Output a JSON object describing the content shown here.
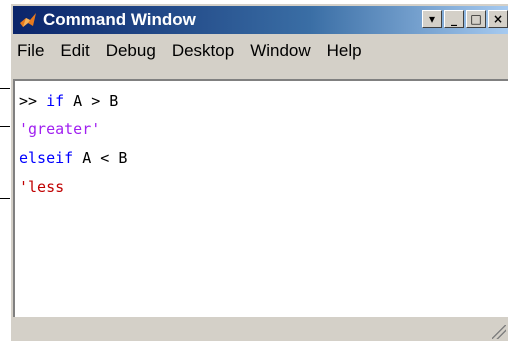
{
  "window": {
    "title": "Command Window",
    "buttons": [
      "▾",
      "_",
      "□",
      "×"
    ]
  },
  "menu": [
    "File",
    "Edit",
    "Debug",
    "Desktop",
    "Window",
    "Help"
  ],
  "console": {
    "line1": {
      "prompt": ">> ",
      "kw": "if",
      "rest": " A > B"
    },
    "line2": {
      "text": "'greater'"
    },
    "line3": {
      "kw": "elseif",
      "rest": " A < B"
    },
    "line4": {
      "text": "'less"
    }
  },
  "colors": {
    "keyword": "#0000ff",
    "string": "#a020f0",
    "unterminated_string": "#c00000"
  }
}
